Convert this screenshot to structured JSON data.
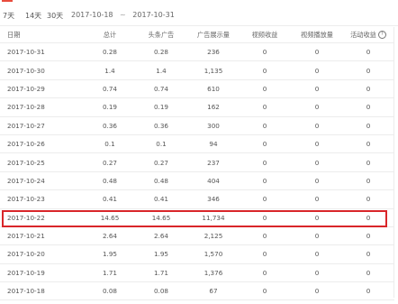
{
  "toolbar": {
    "range_tabs": [
      "7天",
      "14天",
      "30天"
    ],
    "date_start": "2017-10-18",
    "date_sep": "~",
    "date_end": "2017-10-31",
    "accent": "#e84c3d"
  },
  "table": {
    "headers": [
      "日期",
      "总计",
      "头条广告",
      "广告展示量",
      "视频收益",
      "视频播放量",
      "活动收益"
    ],
    "help_icon": "?",
    "rows": [
      [
        "2017-10-31",
        "0.28",
        "0.28",
        "236",
        "0",
        "0",
        "0"
      ],
      [
        "2017-10-30",
        "1.4",
        "1.4",
        "1,135",
        "0",
        "0",
        "0"
      ],
      [
        "2017-10-29",
        "0.74",
        "0.74",
        "610",
        "0",
        "0",
        "0"
      ],
      [
        "2017-10-28",
        "0.19",
        "0.19",
        "162",
        "0",
        "0",
        "0"
      ],
      [
        "2017-10-27",
        "0.36",
        "0.36",
        "300",
        "0",
        "0",
        "0"
      ],
      [
        "2017-10-26",
        "0.1",
        "0.1",
        "94",
        "0",
        "0",
        "0"
      ],
      [
        "2017-10-25",
        "0.27",
        "0.27",
        "237",
        "0",
        "0",
        "0"
      ],
      [
        "2017-10-24",
        "0.48",
        "0.48",
        "404",
        "0",
        "0",
        "0"
      ],
      [
        "2017-10-23",
        "0.41",
        "0.41",
        "346",
        "0",
        "0",
        "0"
      ],
      [
        "2017-10-22",
        "14.65",
        "14.65",
        "11,734",
        "0",
        "0",
        "0"
      ],
      [
        "2017-10-21",
        "2.64",
        "2.64",
        "2,125",
        "0",
        "0",
        "0"
      ],
      [
        "2017-10-20",
        "1.95",
        "1.95",
        "1,570",
        "0",
        "0",
        "0"
      ],
      [
        "2017-10-19",
        "1.71",
        "1.71",
        "1,376",
        "0",
        "0",
        "0"
      ],
      [
        "2017-10-18",
        "0.08",
        "0.08",
        "67",
        "0",
        "0",
        "0"
      ]
    ],
    "highlight_color": "#d9262a"
  }
}
